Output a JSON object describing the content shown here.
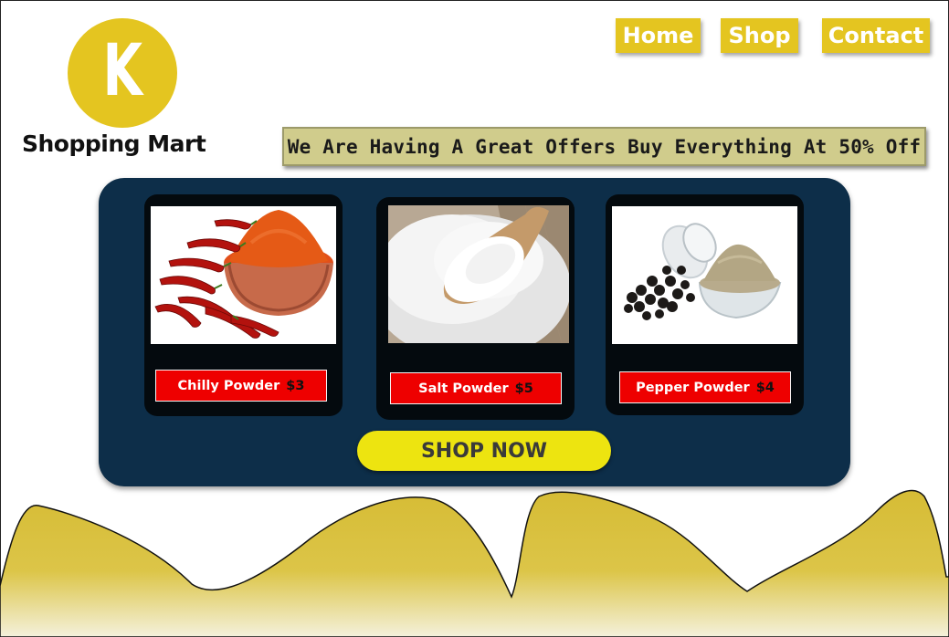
{
  "brand": {
    "logo_letter": "K",
    "name": "Shopping Mart"
  },
  "nav": {
    "home": "Home",
    "shop": "Shop",
    "contact": "Contact"
  },
  "banner": {
    "text": "We Are Having A Great Offers Buy Everything At 50% Off"
  },
  "products": [
    {
      "name": "Chilly Powder",
      "price": "$3",
      "image": "chilli-powder-image"
    },
    {
      "name": "Salt Powder",
      "price": "$5",
      "image": "salt-powder-image"
    },
    {
      "name": "Pepper Powder",
      "price": "$4",
      "image": "pepper-powder-image"
    }
  ],
  "cta": {
    "label": "SHOP NOW"
  },
  "colors": {
    "accent_yellow": "#e4c520",
    "panel_navy": "#0d2e49",
    "price_tag_red": "#ee0000",
    "shop_now_yellow": "#ede410",
    "banner_khaki": "#d0cc8c"
  }
}
